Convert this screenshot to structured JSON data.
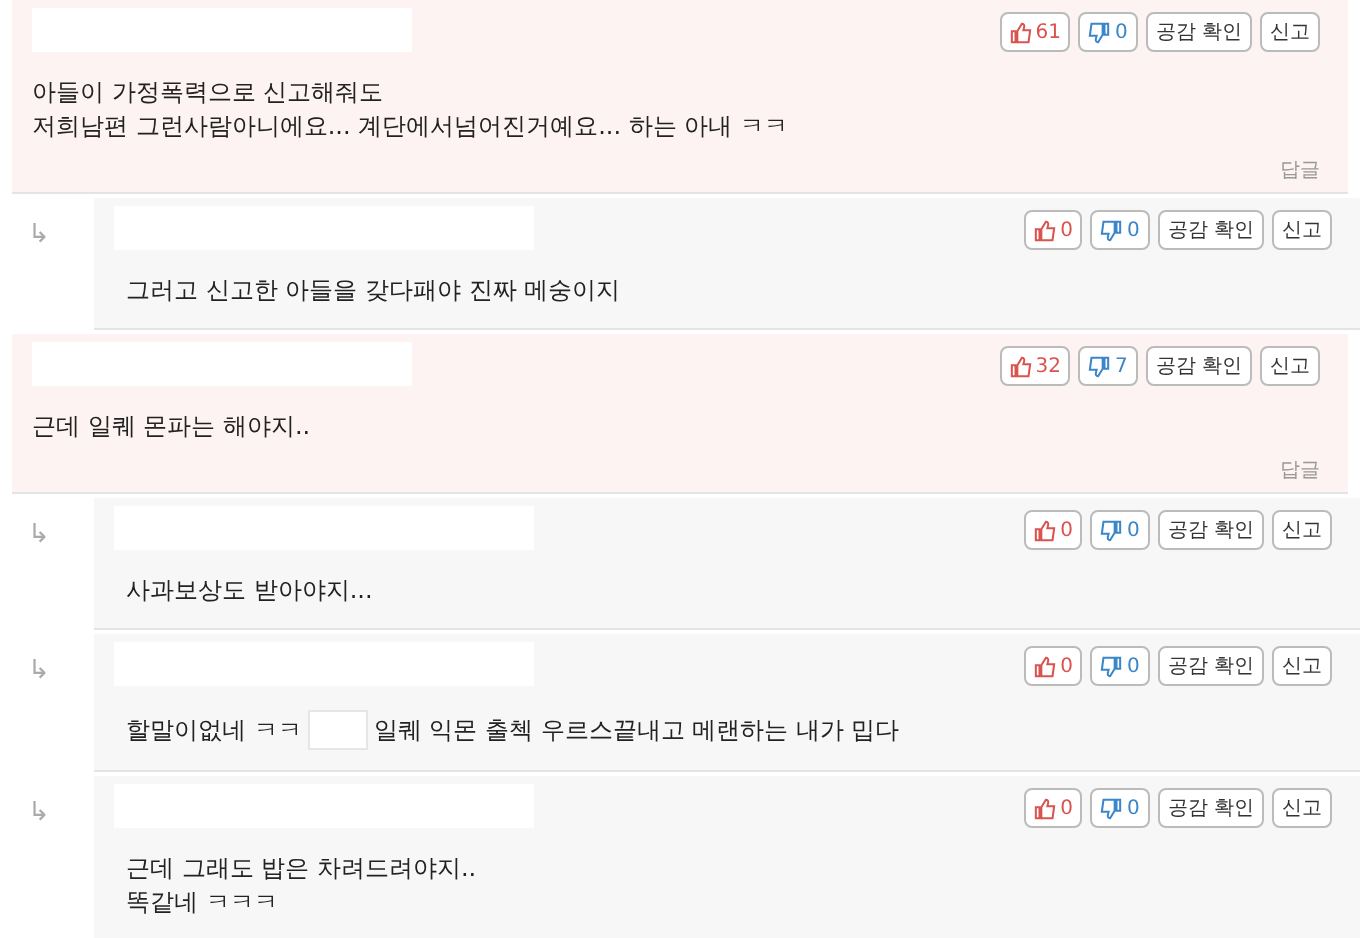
{
  "comments": [
    {
      "kind": "best",
      "likes": "61",
      "dislikes": "0",
      "check_label": "공감 확인",
      "report_label": "신고",
      "reply_label": "답글",
      "lines": [
        [
          {
            "kind": "text",
            "text": "아들이 가정폭력으로 신고해줘도"
          }
        ],
        [
          {
            "kind": "text",
            "text": "저희남편 그런사람아니에요... 계단에서넘어진거예요... 하는 아내 ㅋㅋ"
          }
        ]
      ]
    },
    {
      "kind": "reply",
      "likes": "0",
      "dislikes": "0",
      "check_label": "공감 확인",
      "report_label": "신고",
      "arrow": "↳",
      "lines": [
        [
          {
            "kind": "text",
            "text": "그러고 신고한 아들을 갖다패야 진짜 메숭이지"
          }
        ]
      ]
    },
    {
      "kind": "best",
      "likes": "32",
      "dislikes": "7",
      "check_label": "공감 확인",
      "report_label": "신고",
      "reply_label": "답글",
      "lines": [
        [
          {
            "kind": "text",
            "text": "근데 일퀘 몬파는 해야지.."
          }
        ]
      ]
    },
    {
      "kind": "reply",
      "likes": "0",
      "dislikes": "0",
      "check_label": "공감 확인",
      "report_label": "신고",
      "arrow": "↳",
      "lines": [
        [
          {
            "kind": "text",
            "text": "사과보상도 받아야지..."
          }
        ]
      ]
    },
    {
      "kind": "reply",
      "likes": "0",
      "dislikes": "0",
      "check_label": "공감 확인",
      "report_label": "신고",
      "arrow": "↳",
      "lines": [
        [
          {
            "kind": "text",
            "text": "할말이없네 ㅋㅋ"
          },
          {
            "kind": "redacted"
          },
          {
            "kind": "text",
            "text": "일퀘 익몬 출첵 우르스끝내고 메랜하는 내가 밉다"
          }
        ]
      ]
    },
    {
      "kind": "reply",
      "likes": "0",
      "dislikes": "0",
      "check_label": "공감 확인",
      "report_label": "신고",
      "arrow": "↳",
      "lines": [
        [
          {
            "kind": "text",
            "text": "근데 그래도 밥은 차려드려야지.."
          }
        ],
        [
          {
            "kind": "text",
            "text": "똑같네 ㅋㅋㅋ"
          }
        ]
      ]
    }
  ]
}
